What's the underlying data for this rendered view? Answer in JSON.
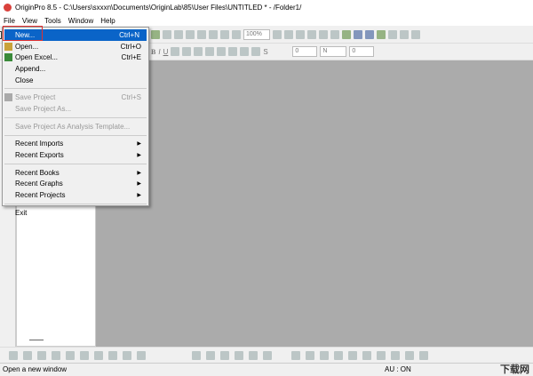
{
  "window": {
    "title": "OriginPro 8.5 - C:\\Users\\sxxxn\\Documents\\OriginLab\\85\\User Files\\UNTITLED * - /Folder1/"
  },
  "menubar": [
    "File",
    "View",
    "Tools",
    "Window",
    "Help"
  ],
  "file_menu": [
    {
      "label": "New...",
      "shortcut": "Ctrl+N",
      "icon": "new-document-icon",
      "state": "selected"
    },
    {
      "label": "Open...",
      "shortcut": "Ctrl+O",
      "icon": "open-folder-icon"
    },
    {
      "label": "Open Excel...",
      "shortcut": "Ctrl+E",
      "icon": "excel-icon"
    },
    {
      "label": "Append..."
    },
    {
      "label": "Close"
    },
    {
      "label": "Save Project",
      "shortcut": "Ctrl+S",
      "icon": "save-icon",
      "state": "disabled"
    },
    {
      "label": "Save Project As...",
      "state": "disabled"
    },
    {
      "label": "Save Project As Analysis Template...",
      "state": "disabled"
    },
    {
      "label": "Recent Imports"
    },
    {
      "label": "Recent Exports"
    },
    {
      "label": "Recent Books"
    },
    {
      "label": "Recent Graphs"
    },
    {
      "label": "Recent Projects"
    },
    {
      "label": "Exit"
    }
  ],
  "toolbar": {
    "zoom": "100%",
    "line_style": "S",
    "width1": "0",
    "color": "N",
    "width2": "0"
  },
  "status": {
    "message": "Open a new window",
    "au": "AU : ON",
    "watermark": "下载网"
  },
  "colors": {
    "accent": "#0a64c8",
    "mdi": "#ababab",
    "highlight": "#e03030"
  }
}
